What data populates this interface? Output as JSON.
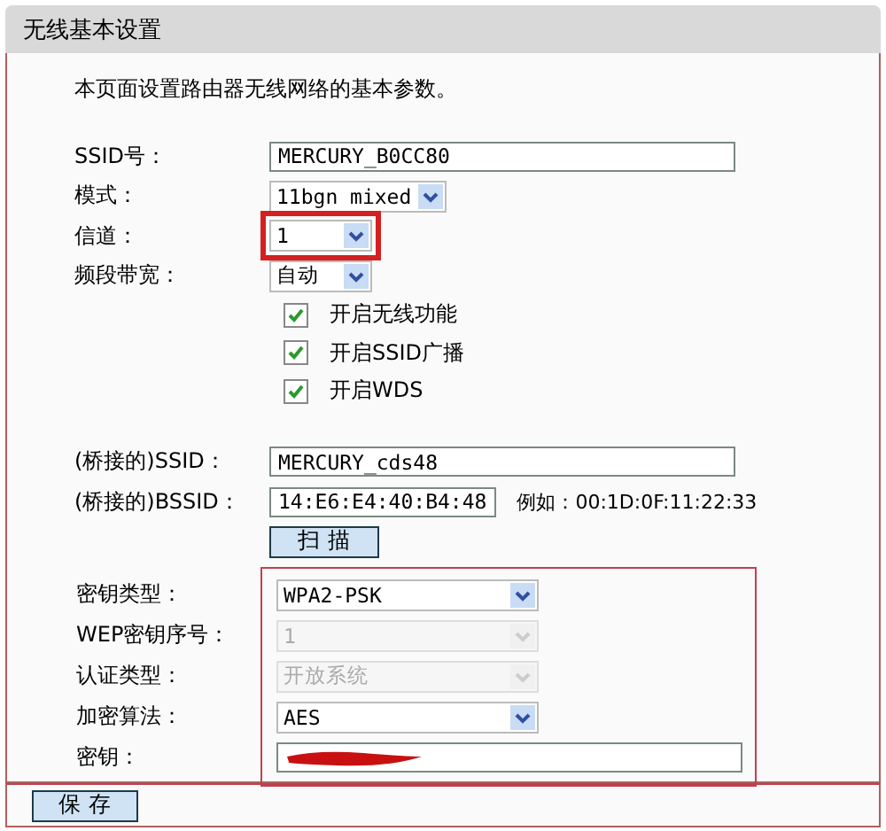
{
  "header": {
    "title": "无线基本设置"
  },
  "intro": "本页面设置路由器无线网络的基本参数。",
  "basic_fields": [
    {
      "label": "SSID号：",
      "kind": "text",
      "value": "MERCURY_B0CC80",
      "highlighted": false
    },
    {
      "label": "模式：",
      "kind": "select",
      "value": "11bgn mixed",
      "highlighted": false
    },
    {
      "label": "信道：",
      "kind": "select",
      "value": "1",
      "highlighted": true
    },
    {
      "label": "频段带宽：",
      "kind": "select",
      "value": "自动",
      "highlighted": false
    }
  ],
  "checkboxes": [
    {
      "label": "开启无线功能",
      "checked": true
    },
    {
      "label": "开启SSID广播",
      "checked": true
    },
    {
      "label": "开启WDS",
      "checked": true
    }
  ],
  "bridge_fields": [
    {
      "label": "(桥接的)SSID：",
      "value": "MERCURY_cds48"
    },
    {
      "label": "(桥接的)BSSID：",
      "value": "14:E6:E4:40:B4:48",
      "example": "例如：00:1D:0F:11:22:33"
    }
  ],
  "scan_button": "扫 描",
  "security_fields": [
    {
      "label": "密钥类型：",
      "kind": "select",
      "value": "WPA2-PSK",
      "disabled": false
    },
    {
      "label": "WEP密钥序号：",
      "kind": "select",
      "value": "1",
      "disabled": true
    },
    {
      "label": "认证类型：",
      "kind": "select",
      "value": "开放系统",
      "disabled": true
    },
    {
      "label": "加密算法：",
      "kind": "select",
      "value": "AES",
      "disabled": false
    },
    {
      "label": "密钥：",
      "kind": "password",
      "redacted": true
    }
  ],
  "save_button": "保 存"
}
